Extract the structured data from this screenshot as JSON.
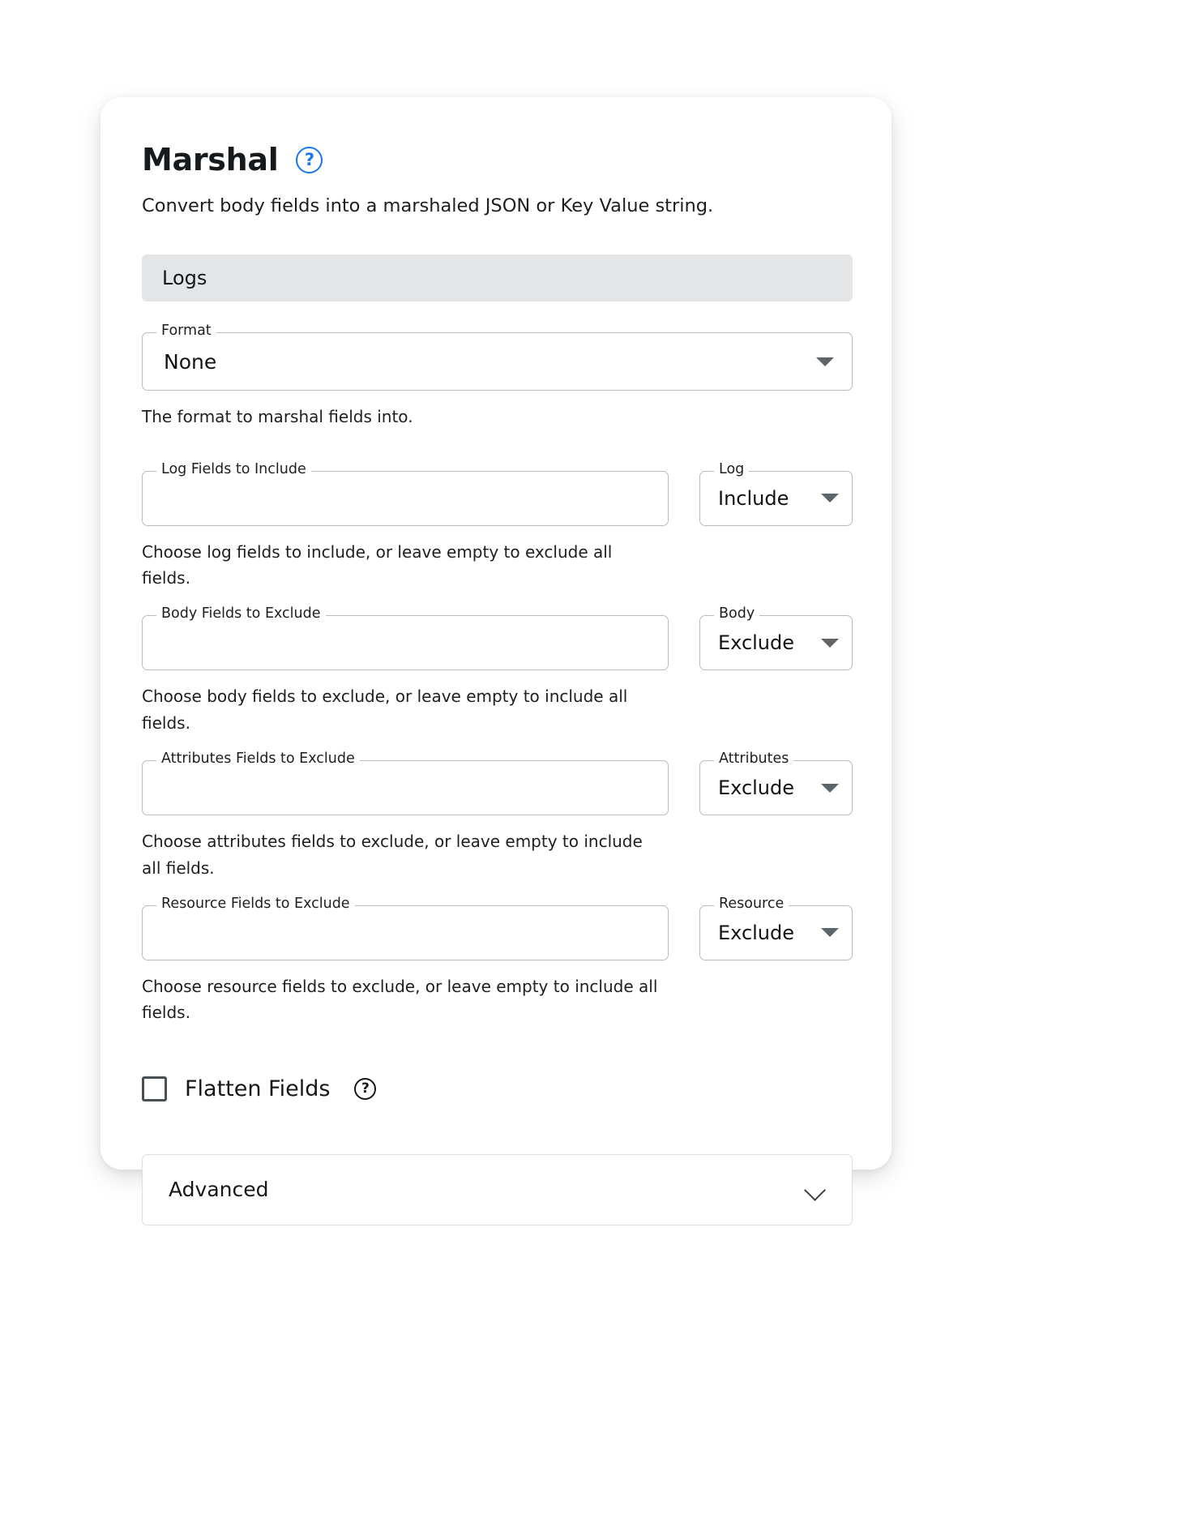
{
  "header": {
    "title": "Marshal",
    "help_icon_label": "?",
    "subtitle": "Convert body fields into a marshaled JSON or Key Value string."
  },
  "section": {
    "label": "Logs"
  },
  "format": {
    "legend": "Format",
    "value": "None",
    "helper": "The format to marshal fields into.",
    "caret_icon": "chevron-down-icon"
  },
  "rows": [
    {
      "input_legend": "Log Fields to Include",
      "input_value": "",
      "input_placeholder": "",
      "helper": "Choose log fields to include, or leave empty to exclude all fields.",
      "select_legend": "Log",
      "select_value": "Include"
    },
    {
      "input_legend": "Body Fields to Exclude",
      "input_value": "",
      "input_placeholder": "",
      "helper": "Choose body fields to exclude, or leave empty to include all fields.",
      "select_legend": "Body",
      "select_value": "Exclude"
    },
    {
      "input_legend": "Attributes Fields to Exclude",
      "input_value": "",
      "input_placeholder": "",
      "helper": "Choose attributes fields to exclude, or leave empty to include all fields.",
      "select_legend": "Attributes",
      "select_value": "Exclude"
    },
    {
      "input_legend": "Resource Fields to Exclude",
      "input_value": "",
      "input_placeholder": "",
      "helper": "Choose resource fields to exclude, or leave empty to include all fields.",
      "select_legend": "Resource",
      "select_value": "Exclude"
    }
  ],
  "flatten": {
    "label": "Flatten Fields",
    "checked": false,
    "help_icon_label": "?"
  },
  "advanced": {
    "label": "Advanced",
    "chevron_icon": "chevron-down-icon"
  },
  "colors": {
    "accent_blue": "#1976ef",
    "section_bar": "#e4e5e7",
    "field_border": "#b9bcbf",
    "text": "#15181a"
  }
}
